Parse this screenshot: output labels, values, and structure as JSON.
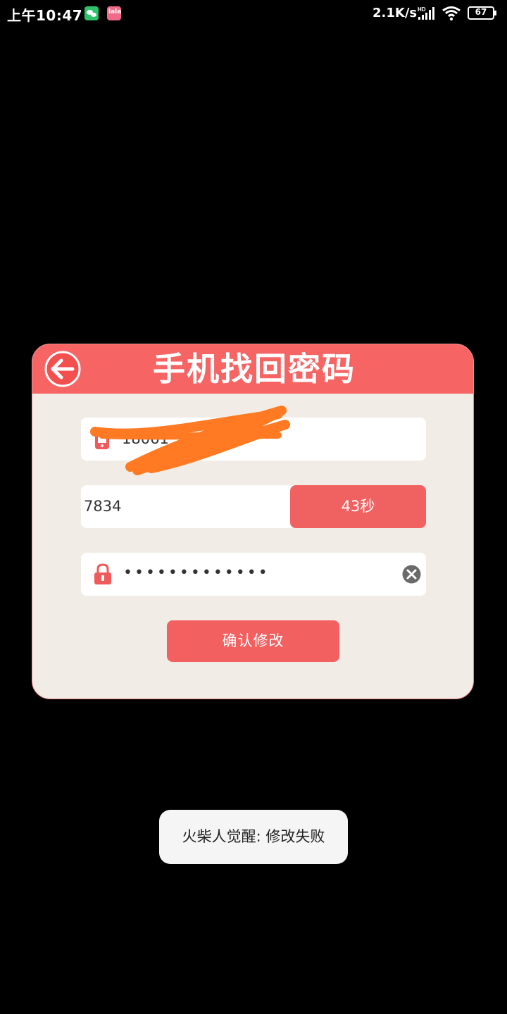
{
  "status_bar": {
    "time": "上午10:47",
    "net_speed": "2.1K/s",
    "signal_label": "HD",
    "battery": "67"
  },
  "dialog": {
    "title": "手机找回密码",
    "phone_value": "18061",
    "code_value": "7834",
    "countdown_label": "43秒",
    "password_mask": "•••••••••••••",
    "confirm_label": "确认修改"
  },
  "toast": {
    "message": "火柴人觉醒: 修改失败"
  },
  "colors": {
    "accent": "#f66464",
    "dialog_bg": "#f1ede6",
    "scribble": "#ff7a22"
  },
  "icons": {
    "back": "back-arrow-icon",
    "phone": "phone-icon",
    "lock": "lock-icon",
    "clear": "clear-icon"
  }
}
